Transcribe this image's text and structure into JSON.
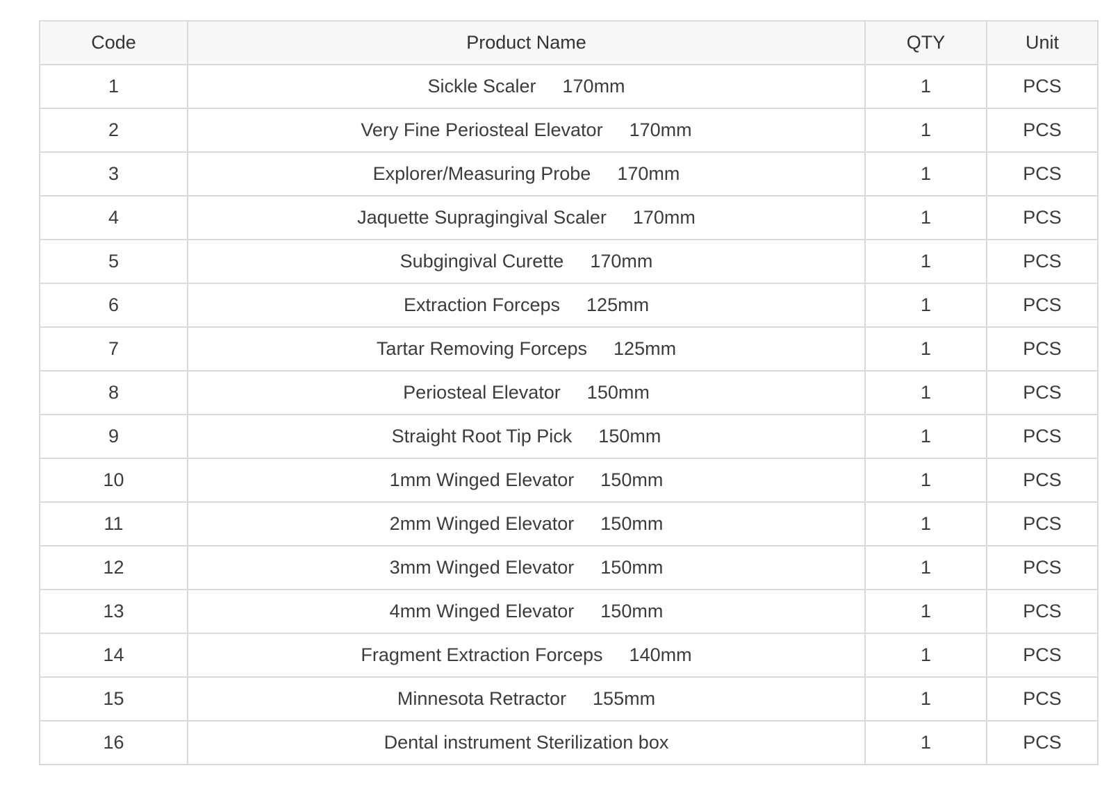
{
  "table": {
    "headers": {
      "code": "Code",
      "name": "Product Name",
      "qty": "QTY",
      "unit": "Unit"
    },
    "rows": [
      {
        "code": "1",
        "name": "Sickle Scaler",
        "size": "170mm",
        "qty": "1",
        "unit": "PCS"
      },
      {
        "code": "2",
        "name": "Very Fine Periosteal Elevator",
        "size": "170mm",
        "qty": "1",
        "unit": "PCS"
      },
      {
        "code": "3",
        "name": "Explorer/Measuring Probe",
        "size": "170mm",
        "qty": "1",
        "unit": "PCS"
      },
      {
        "code": "4",
        "name": "Jaquette Supragingival Scaler",
        "size": "170mm",
        "qty": "1",
        "unit": "PCS"
      },
      {
        "code": "5",
        "name": "Subgingival Curette",
        "size": "170mm",
        "qty": "1",
        "unit": "PCS"
      },
      {
        "code": "6",
        "name": "Extraction Forceps",
        "size": "125mm",
        "qty": "1",
        "unit": "PCS"
      },
      {
        "code": "7",
        "name": "Tartar Removing Forceps",
        "size": "125mm",
        "qty": "1",
        "unit": "PCS"
      },
      {
        "code": "8",
        "name": "Periosteal Elevator",
        "size": "150mm",
        "qty": "1",
        "unit": "PCS"
      },
      {
        "code": "9",
        "name": "Straight Root Tip Pick",
        "size": "150mm",
        "qty": "1",
        "unit": "PCS"
      },
      {
        "code": "10",
        "name": "1mm Winged Elevator",
        "size": "150mm",
        "qty": "1",
        "unit": "PCS"
      },
      {
        "code": "11",
        "name": "2mm Winged Elevator",
        "size": "150mm",
        "qty": "1",
        "unit": "PCS"
      },
      {
        "code": "12",
        "name": "3mm Winged Elevator",
        "size": "150mm",
        "qty": "1",
        "unit": "PCS"
      },
      {
        "code": "13",
        "name": "4mm Winged Elevator",
        "size": "150mm",
        "qty": "1",
        "unit": "PCS"
      },
      {
        "code": "14",
        "name": "Fragment Extraction Forceps",
        "size": "140mm",
        "qty": "1",
        "unit": "PCS"
      },
      {
        "code": "15",
        "name": "Minnesota Retractor",
        "size": "155mm",
        "qty": "1",
        "unit": "PCS"
      },
      {
        "code": "16",
        "name": "Dental instrument Sterilization box",
        "size": "",
        "qty": "1",
        "unit": "PCS"
      }
    ]
  }
}
